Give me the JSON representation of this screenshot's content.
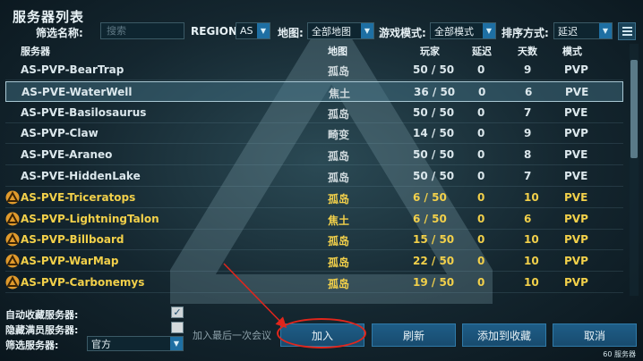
{
  "title": "服务器列表",
  "filters": {
    "search_label": "筛选名称:",
    "search_placeholder": "搜索",
    "region_label": "REGION:",
    "region_value": "AS",
    "map_label": "地图:",
    "map_value": "全部地图",
    "mode_label": "游戏模式:",
    "mode_value": "全部模式",
    "sort_label": "排序方式:",
    "sort_value": "延迟"
  },
  "columns": [
    "服务器",
    "地图",
    "玩家",
    "延迟",
    "天数",
    "模式"
  ],
  "rows": [
    {
      "name": "AS-PVP-BearTrap",
      "map": "孤岛",
      "players": "50 / 50",
      "ping": "0",
      "days": "9",
      "mode": "PVP",
      "official": false,
      "selected": false
    },
    {
      "name": "AS-PVE-WaterWell",
      "map": "焦土",
      "players": "36 / 50",
      "ping": "0",
      "days": "6",
      "mode": "PVE",
      "official": false,
      "selected": true
    },
    {
      "name": "AS-PVE-Basilosaurus",
      "map": "孤岛",
      "players": "50 / 50",
      "ping": "0",
      "days": "7",
      "mode": "PVE",
      "official": false,
      "selected": false
    },
    {
      "name": "AS-PVP-Claw",
      "map": "畸变",
      "players": "14 / 50",
      "ping": "0",
      "days": "9",
      "mode": "PVP",
      "official": false,
      "selected": false
    },
    {
      "name": "AS-PVE-Araneo",
      "map": "孤岛",
      "players": "50 / 50",
      "ping": "0",
      "days": "8",
      "mode": "PVE",
      "official": false,
      "selected": false
    },
    {
      "name": "AS-PVE-HiddenLake",
      "map": "孤岛",
      "players": "50 / 50",
      "ping": "0",
      "days": "7",
      "mode": "PVE",
      "official": false,
      "selected": false
    },
    {
      "name": "AS-PVE-Triceratops",
      "map": "孤岛",
      "players": "6 / 50",
      "ping": "0",
      "days": "10",
      "mode": "PVE",
      "official": true,
      "selected": false
    },
    {
      "name": "AS-PVP-LightningTalon",
      "map": "焦土",
      "players": "6 / 50",
      "ping": "0",
      "days": "6",
      "mode": "PVP",
      "official": true,
      "selected": false
    },
    {
      "name": "AS-PVP-Billboard",
      "map": "孤岛",
      "players": "15 / 50",
      "ping": "0",
      "days": "10",
      "mode": "PVP",
      "official": true,
      "selected": false
    },
    {
      "name": "AS-PVP-WarMap",
      "map": "孤岛",
      "players": "22 / 50",
      "ping": "0",
      "days": "10",
      "mode": "PVP",
      "official": true,
      "selected": false
    },
    {
      "name": "AS-PVP-Carbonemys",
      "map": "孤岛",
      "players": "19 / 50",
      "ping": "0",
      "days": "10",
      "mode": "PVP",
      "official": true,
      "selected": false
    }
  ],
  "options": {
    "auto_favorite_label": "自动收藏服务器:",
    "auto_favorite_checked": true,
    "hide_full_label": "隐藏满员服务器:",
    "hide_full_checked": false,
    "filter_servers_label": "筛选服务器:",
    "filter_servers_value": "官方"
  },
  "buttons": {
    "join_last": "加入最后一次会议",
    "join": "加入",
    "refresh": "刷新",
    "add_favorite": "添加到收藏",
    "cancel": "取消"
  },
  "server_count": "60 服务器",
  "colors": {
    "official_text": "#f2d04a",
    "button_bg": "#1e5d87",
    "annotation_red": "#e0261c"
  }
}
